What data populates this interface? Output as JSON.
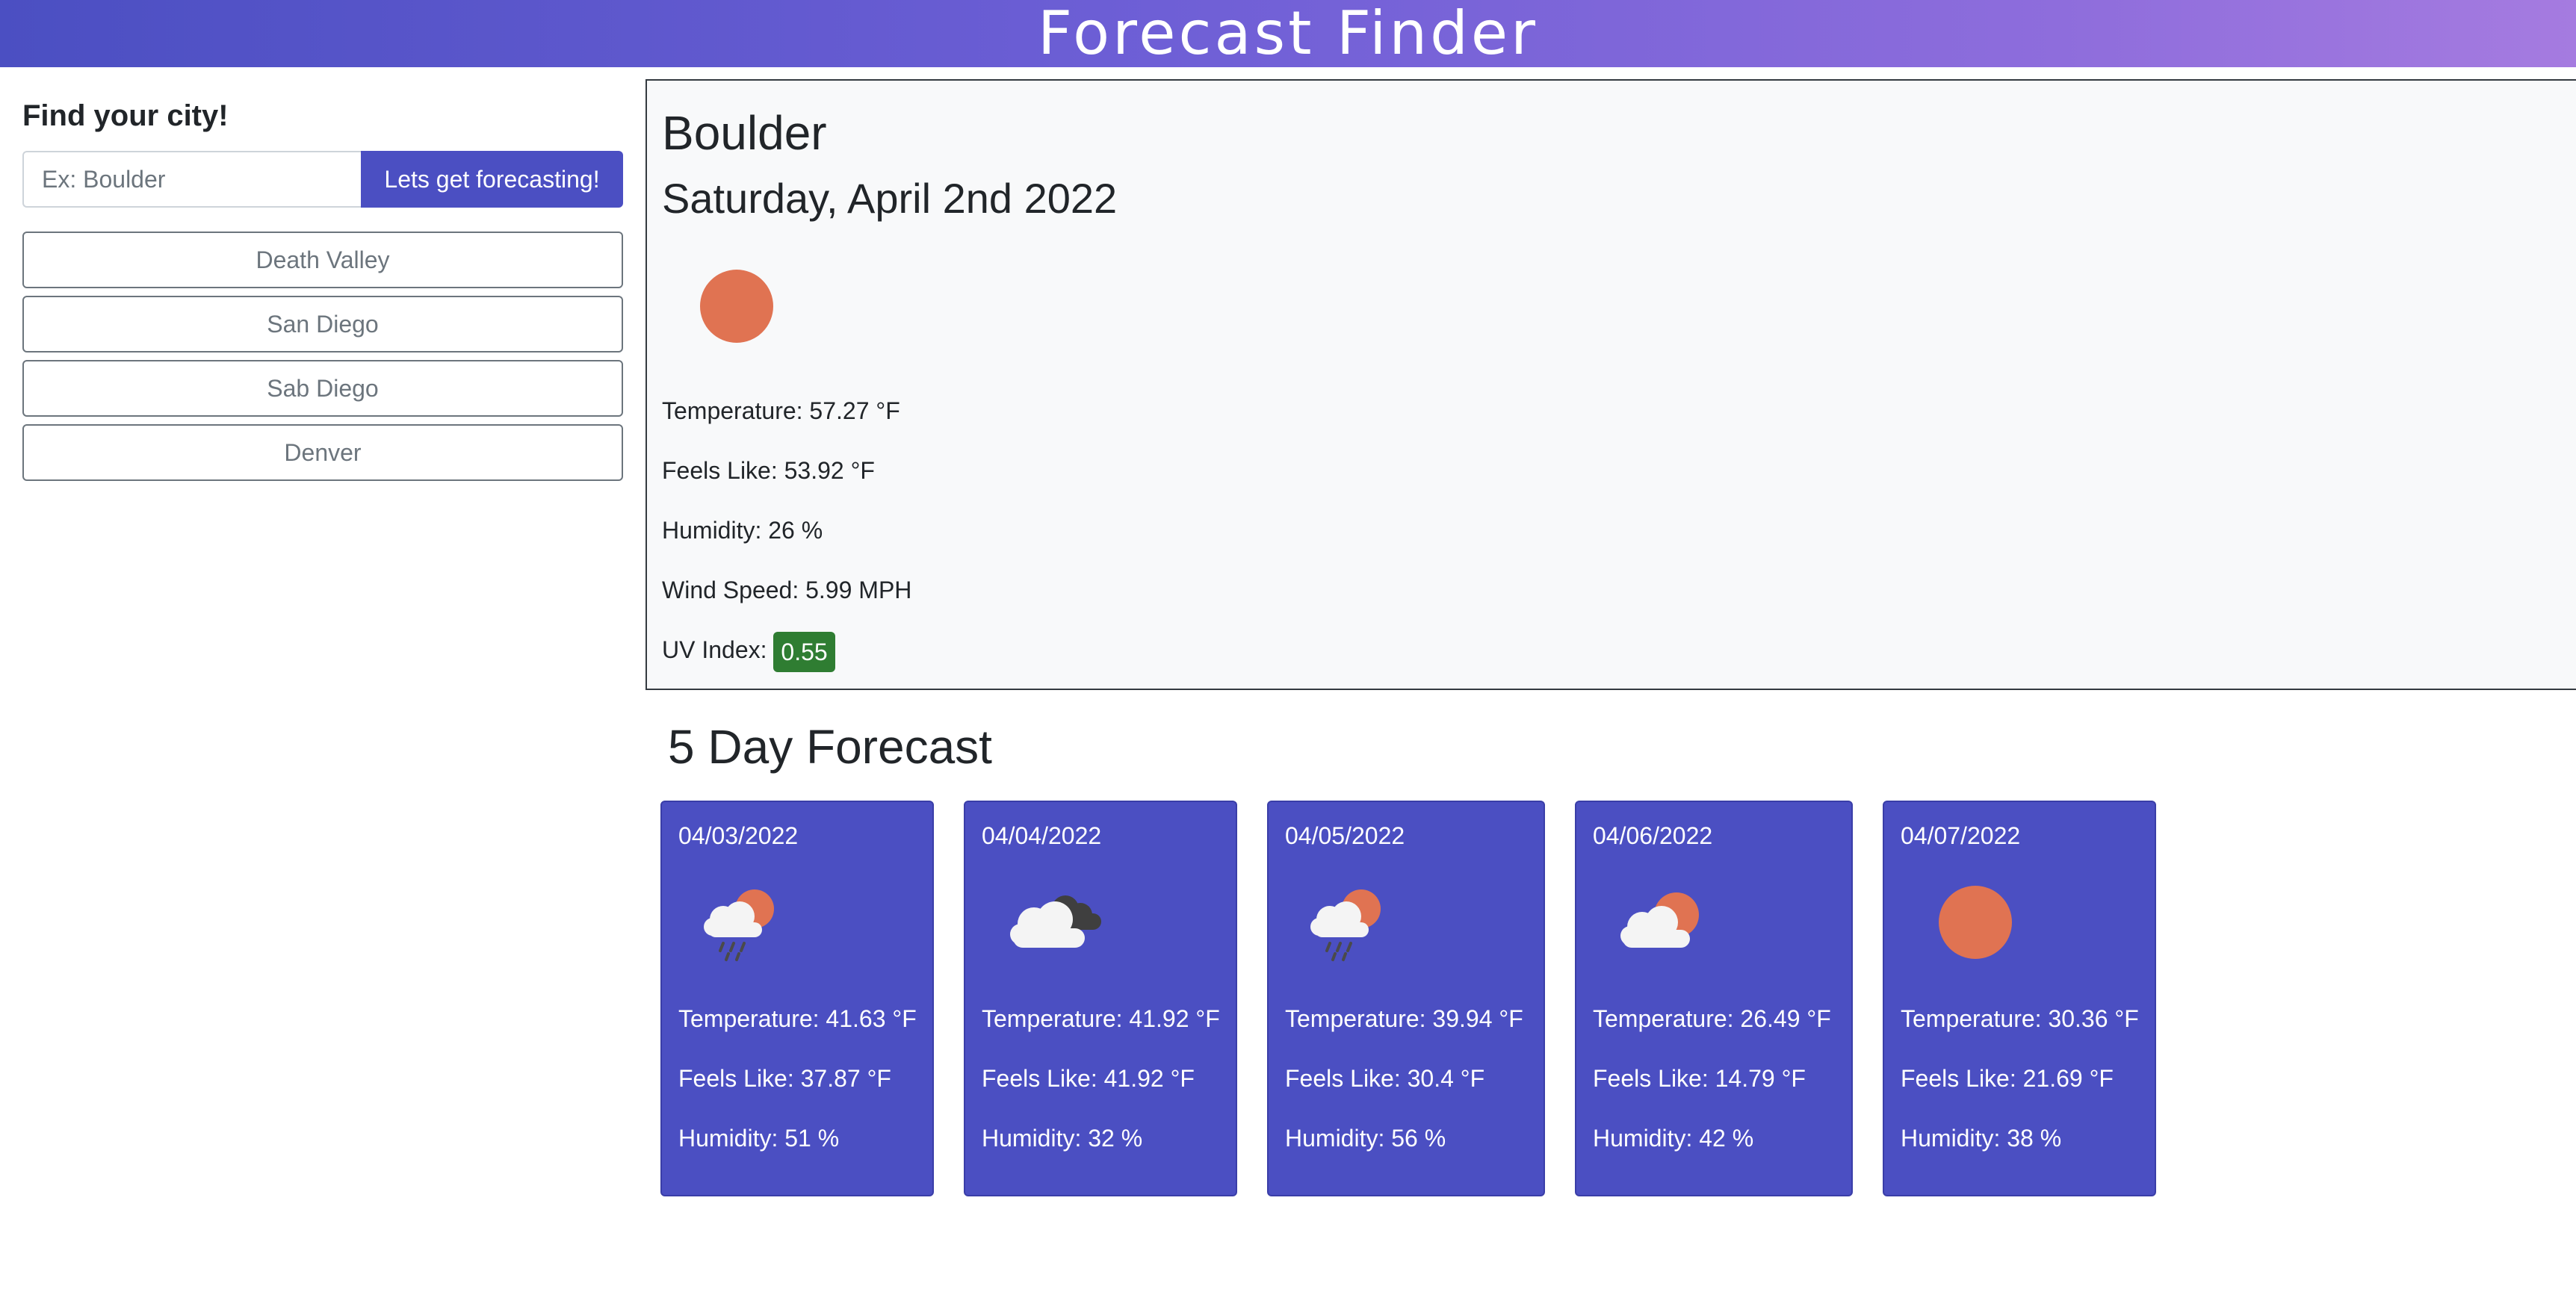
{
  "header": {
    "title": "Forecast Finder",
    "gradient": [
      "#4b4fc2",
      "#a57be0"
    ]
  },
  "sidebar": {
    "heading": "Find your city!",
    "search": {
      "value": "",
      "placeholder": "Ex: Boulder",
      "button_label": "Lets get forecasting!"
    },
    "history": [
      "Death Valley",
      "San Diego",
      "Sab Diego",
      "Denver"
    ]
  },
  "current": {
    "city": "Boulder",
    "date": "Saturday, April 2nd 2022",
    "icon": "sun-icon",
    "temperature": "Temperature: 57.27 °F",
    "feels_like": "Feels Like: 53.92 °F",
    "humidity": "Humidity: 26 %",
    "wind_speed": "Wind Speed: 5.99 MPH",
    "uv_label": "UV Index:",
    "uv_value": "0.55",
    "uv_color": "#2f7d32"
  },
  "forecast": {
    "title": "5 Day Forecast",
    "accent": "#4b4fc2",
    "days": [
      {
        "date": "04/03/2022",
        "icon": "sun-cloud-rain-icon",
        "temperature": "Temperature: 41.63 °F",
        "feels_like": "Feels Like: 37.87 °F",
        "humidity": "Humidity: 51 %"
      },
      {
        "date": "04/04/2022",
        "icon": "broken-clouds-icon",
        "temperature": "Temperature: 41.92 °F",
        "feels_like": "Feels Like: 41.92 °F",
        "humidity": "Humidity: 32 %"
      },
      {
        "date": "04/05/2022",
        "icon": "sun-cloud-rain-icon",
        "temperature": "Temperature: 39.94 °F",
        "feels_like": "Feels Like: 30.4 °F",
        "humidity": "Humidity: 56 %"
      },
      {
        "date": "04/06/2022",
        "icon": "partly-cloudy-icon",
        "temperature": "Temperature: 26.49 °F",
        "feels_like": "Feels Like: 14.79 °F",
        "humidity": "Humidity: 42 %"
      },
      {
        "date": "04/07/2022",
        "icon": "sun-icon",
        "temperature": "Temperature: 30.36 °F",
        "feels_like": "Feels Like: 21.69 °F",
        "humidity": "Humidity: 38 %"
      }
    ]
  }
}
